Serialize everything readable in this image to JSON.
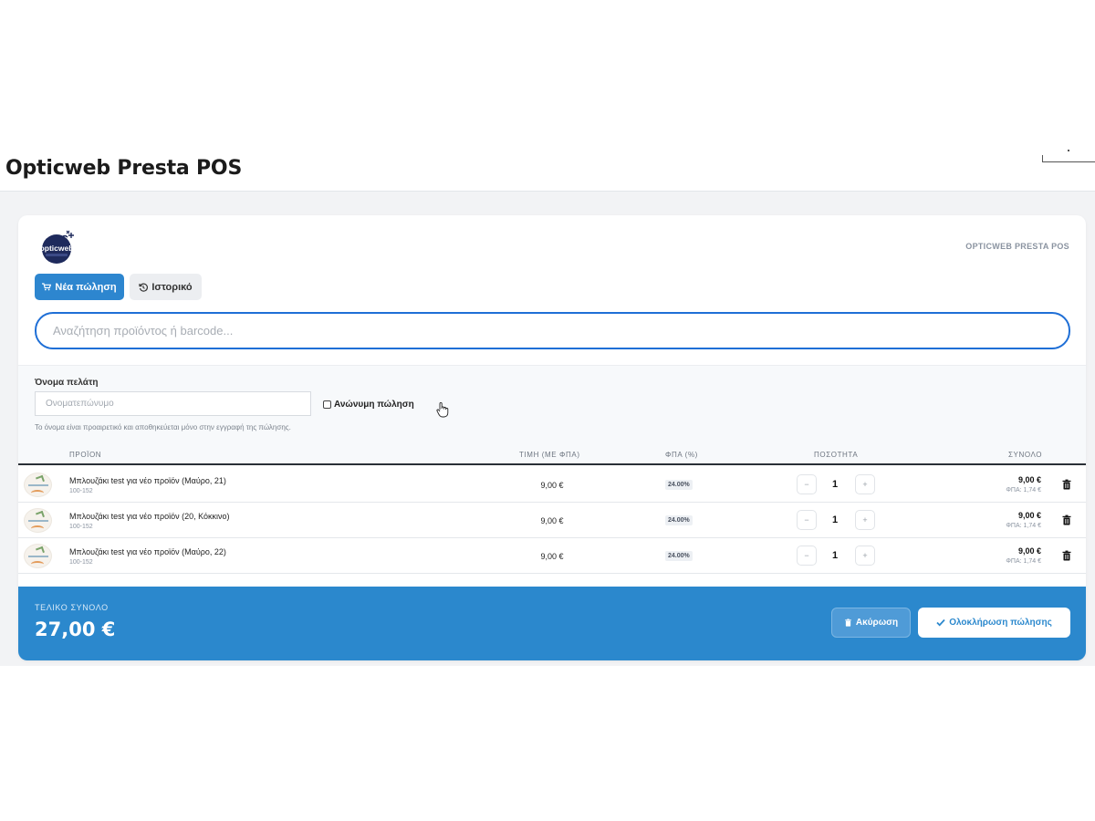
{
  "page": {
    "title": "Opticweb Presta POS"
  },
  "app": {
    "logo_text": "opticweb",
    "label": "OPTICWEB PRESTA POS",
    "accent": "#2d86cf"
  },
  "nav": {
    "new_sale": "Νέα πώληση",
    "new_sale_icon": "cart-icon",
    "history": "Ιστορικό",
    "history_icon": "history-icon"
  },
  "search": {
    "placeholder": "Αναζήτηση προϊόντος ή barcode..."
  },
  "customer": {
    "label": "Όνομα πελάτη",
    "placeholder": "Ονοματεπώνυμο",
    "value": "",
    "anonymous_label": "Ανώνυμη πώληση",
    "anonymous_checked": false,
    "help": "Το όνομα είναι προαιρετικό και αποθηκεύεται μόνο στην εγγραφή της πώλησης."
  },
  "table": {
    "headers": [
      "ΠΡΟΪΟΝ",
      "ΤΙΜΗ (ΜΕ ΦΠΑ)",
      "ΦΠΑ (%)",
      "ΠΟΣΟΤΗΤΑ",
      "ΣΥΝΟΛΟ"
    ],
    "rows": [
      {
        "name": "Μπλουζάκι test για νέο προϊόν (Μαύρο, 21)",
        "ref": "100-152",
        "price": "9,00 €",
        "vat": "24.00%",
        "qty": "1",
        "total": "9,00 €",
        "vat_amount": "ΦΠΑ: 1,74 €"
      },
      {
        "name": "Μπλουζάκι test για νέο προϊόν (20, Κόκκινο)",
        "ref": "100-152",
        "price": "9,00 €",
        "vat": "24.00%",
        "qty": "1",
        "total": "9,00 €",
        "vat_amount": "ΦΠΑ: 1,74 €"
      },
      {
        "name": "Μπλουζάκι test για νέο προϊόν (Μαύρο, 22)",
        "ref": "100-152",
        "price": "9,00 €",
        "vat": "24.00%",
        "qty": "1",
        "total": "9,00 €",
        "vat_amount": "ΦΠΑ: 1,74 €"
      }
    ],
    "minus": "−",
    "plus": "+"
  },
  "footer": {
    "label": "ΤΕΛΙΚΟ ΣΥΝΟΛΟ",
    "total": "27,00 €",
    "cancel": "Ακύρωση",
    "complete": "Ολοκλήρωση πώλησης",
    "color": "#2b88cd"
  }
}
